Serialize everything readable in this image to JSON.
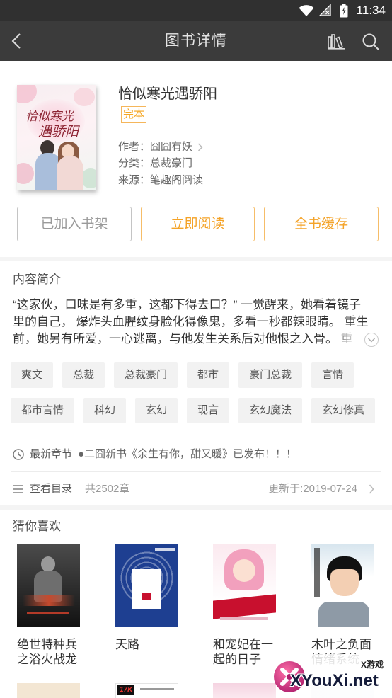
{
  "status_bar": {
    "time": "11:34"
  },
  "header": {
    "title": "图书详情"
  },
  "book": {
    "title": "恰似寒光遇骄阳",
    "status_badge": "完本",
    "author_label": "作者：",
    "author": "囧囧有妖",
    "category_label": "分类：",
    "category": "总裁豪门",
    "source_label": "来源：",
    "source": "笔趣阁阅读",
    "cover_art": [
      "恰似寒光",
      "遇骄阳"
    ]
  },
  "actions": {
    "add_to_shelf": "已加入书架",
    "read_now": "立即阅读",
    "cache_all": "全书缓存"
  },
  "intro": {
    "heading": "内容简介",
    "lines": [
      "“这家伙，口味是有多重，这都下得去口？” 一觉醒来，她看着镜子",
      "里的自己， 爆炸头血腥纹身脸化得像鬼，多看一秒都辣眼睛。 重生",
      "前，她另有所爱，一心逃离，与他发生关系后对他恨之入骨。 重"
    ]
  },
  "tags": [
    "爽文",
    "总裁",
    "总裁豪门",
    "都市",
    "豪门总裁",
    "言情",
    "都市言情",
    "科幻",
    "玄幻",
    "现言",
    "玄幻魔法",
    "玄幻修真"
  ],
  "latest_chapter": {
    "label": "最新章节",
    "text": "●二囧新书《余生有你，甜又暖》已发布！！！"
  },
  "catalog": {
    "label": "查看目录",
    "count": "共2502章",
    "updated": "更新于:2019-07-24"
  },
  "recommend": {
    "heading": "猜你喜欢",
    "books": [
      {
        "title": "绝世特种兵之浴火战龙"
      },
      {
        "title": "天路"
      },
      {
        "title": "和宠妃在一起的日子"
      },
      {
        "title": "木叶之负面情绪系统"
      }
    ],
    "partial_cover_logo": "17K"
  },
  "watermark": {
    "brand": "XYouXi.net",
    "tag": "X游戏"
  },
  "icons": {
    "status": [
      "wifi-icon",
      "no-signal-icon",
      "battery-charging-icon"
    ],
    "header_left": "back-arrow-icon",
    "header_right": [
      "bookshelf-icon",
      "search-icon"
    ],
    "author_more": "chevron-right-icon",
    "intro_expand": "chevron-down-circle-icon",
    "latest_chapter": "clock-icon",
    "catalog": "list-icon",
    "catalog_more": "chevron-right-icon"
  },
  "colors": {
    "status_bar_bg": "#303030",
    "header_bg": "#3b3b3b",
    "accent": "#f5a623",
    "tag_bg": "#f2f2f2",
    "muted_text": "#999999"
  }
}
